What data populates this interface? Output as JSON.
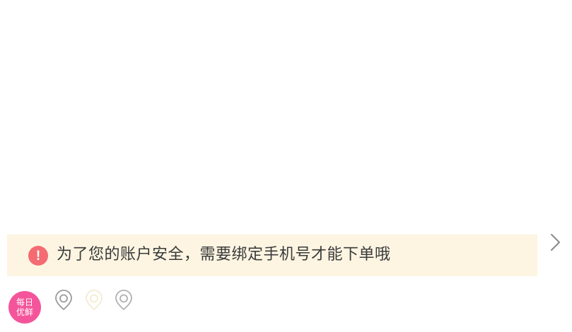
{
  "notice": {
    "icon": "exclamation-icon",
    "icon_glyph": "!",
    "text": "为了您的账户安全，需要绑定手机号才能下单哦",
    "background": "#fdf5e2",
    "icon_color": "#f56b72"
  },
  "navigation": {
    "chevron_icon": "chevron-right-icon"
  },
  "brand": {
    "line1": "每日",
    "line2": "优鲜",
    "color": "#f4559a"
  },
  "bottom_icons": [
    "location-pin-icon",
    "location-pin-icon-faded",
    "location-pin-icon"
  ]
}
